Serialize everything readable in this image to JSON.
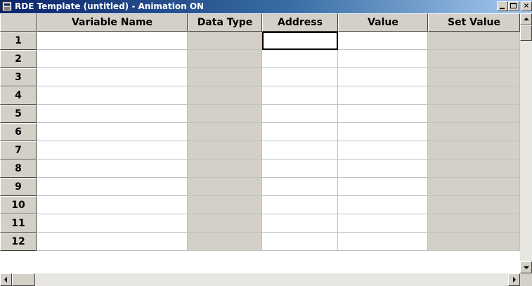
{
  "window": {
    "title": "RDE Template (untitled) - Animation ON",
    "icon": "rde-app-icon",
    "controls": {
      "minimize": "minimize-icon",
      "maximize": "maximize-icon",
      "close": "×"
    }
  },
  "table": {
    "columns": [
      "Variable Name",
      "Data Type",
      "Address",
      "Value",
      "Set Value"
    ],
    "rows": [
      {
        "num": "1",
        "variable_name": "",
        "data_type": "",
        "address": "",
        "value": "",
        "set_value": ""
      },
      {
        "num": "2",
        "variable_name": "",
        "data_type": "",
        "address": "",
        "value": "",
        "set_value": ""
      },
      {
        "num": "3",
        "variable_name": "",
        "data_type": "",
        "address": "",
        "value": "",
        "set_value": ""
      },
      {
        "num": "4",
        "variable_name": "",
        "data_type": "",
        "address": "",
        "value": "",
        "set_value": ""
      },
      {
        "num": "5",
        "variable_name": "",
        "data_type": "",
        "address": "",
        "value": "",
        "set_value": ""
      },
      {
        "num": "6",
        "variable_name": "",
        "data_type": "",
        "address": "",
        "value": "",
        "set_value": ""
      },
      {
        "num": "7",
        "variable_name": "",
        "data_type": "",
        "address": "",
        "value": "",
        "set_value": ""
      },
      {
        "num": "8",
        "variable_name": "",
        "data_type": "",
        "address": "",
        "value": "",
        "set_value": ""
      },
      {
        "num": "9",
        "variable_name": "",
        "data_type": "",
        "address": "",
        "value": "",
        "set_value": ""
      },
      {
        "num": "10",
        "variable_name": "",
        "data_type": "",
        "address": "",
        "value": "",
        "set_value": ""
      },
      {
        "num": "11",
        "variable_name": "",
        "data_type": "",
        "address": "",
        "value": "",
        "set_value": ""
      },
      {
        "num": "12",
        "variable_name": "",
        "data_type": "",
        "address": "",
        "value": "",
        "set_value": ""
      }
    ],
    "active_cell": {
      "row": "1",
      "column": "Address"
    }
  },
  "colors": {
    "title_bar_start": "#0a246a",
    "title_bar_end": "#a6caf0",
    "chrome": "#d4d0c8",
    "cell_background": "#ffffff",
    "readonly_cell": "#d4d0c8"
  }
}
